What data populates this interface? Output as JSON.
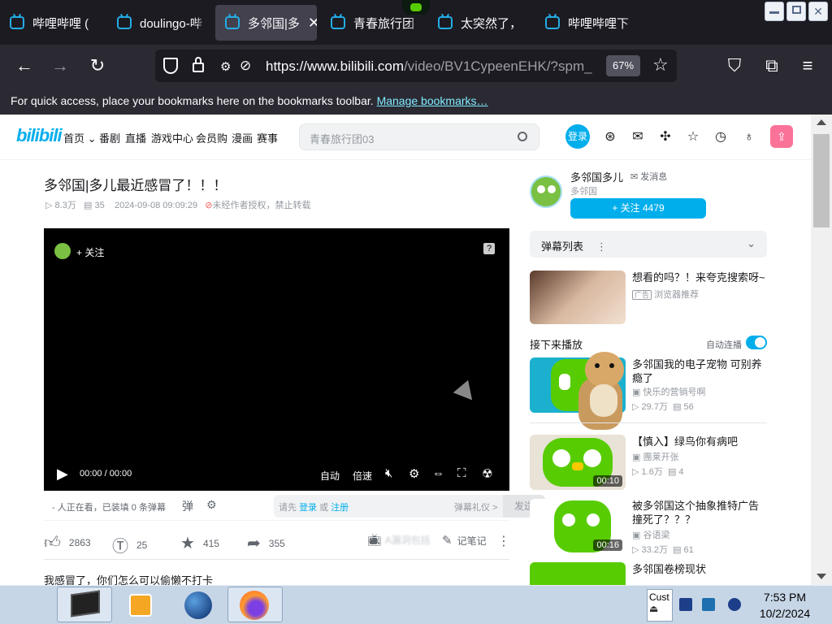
{
  "browser": {
    "tabs": [
      {
        "label": "哔哩哔哩 (",
        "active": false
      },
      {
        "label": "doulingo-哔",
        "active": false
      },
      {
        "label": "多邻国|多",
        "active": true
      },
      {
        "label": "青春旅行团",
        "active": false
      },
      {
        "label": "太突然了，",
        "active": false
      },
      {
        "label": "哔哩哔哩下",
        "active": false
      }
    ],
    "url_main": "https://www.bilibili.com",
    "url_rest": "/video/BV1CypeenEHK/?spm_",
    "zoom": "67%",
    "bookmarks_text": "For quick access, place your bookmarks here on the bookmarks toolbar.",
    "bookmarks_link": "Manage bookmarks…"
  },
  "site": {
    "logo": "bilibili",
    "nav": [
      "首页",
      "番剧",
      "直播",
      "游戏中心",
      "会员购",
      "漫画",
      "赛事"
    ],
    "search_placeholder": "青春旅行团03",
    "login": "登录"
  },
  "video": {
    "title": "多邻国|多儿最近感冒了！！！",
    "views": "8.3万",
    "danmaku_count": "35",
    "date": "2024-09-08 09:09:29",
    "copyright": "未经作者授权，禁止转载",
    "follow_in_player": "+ 关注",
    "time": "00:00 / 00:00",
    "auto": "自动",
    "speed": "倍速",
    "watching": "- 人正在看，已装填 0 条弹幕",
    "dm_prompt_pre": "请先",
    "dm_login": "登录",
    "dm_or": "或",
    "dm_register": "注册",
    "dm_gift": "弹幕礼仪 >",
    "dm_send": "发送",
    "likes": "2863",
    "coins": "25",
    "favs": "415",
    "shares": "355",
    "note": "记笔记",
    "desc": "我感冒了，你们怎么可以偷懒不打卡"
  },
  "uploader": {
    "name": "多邻国多儿",
    "message": "发消息",
    "sub": "多邻国",
    "follow": "+ 关注 4479"
  },
  "sidebar": {
    "danmaku_list": "弹幕列表",
    "ad_title": "想看的吗？！来夸克搜索呀~",
    "ad_tag": "广告",
    "ad_source": "浏览器推荐",
    "next_up": "接下来播放",
    "autoplay": "自动连播",
    "videos": [
      {
        "title": "多邻国我的电子宠物 可别养瘾了",
        "author": "快乐的营销号啊",
        "views": "29.7万",
        "dm": "56",
        "duration": ""
      },
      {
        "title": "【慎入】绿鸟你有病吧",
        "author": "團莱开张",
        "views": "1.6万",
        "dm": "4",
        "duration": "00:10"
      },
      {
        "title": "被多邻国这个抽象推特广告撞死了？？？",
        "author": "谷语梁",
        "views": "33.2万",
        "dm": "61",
        "duration": "00:16"
      },
      {
        "title": "多邻国卷榜现状",
        "author": "",
        "views": "",
        "dm": "",
        "duration": ""
      }
    ]
  },
  "taskbar": {
    "time": "7:53 PM",
    "date": "10/2/2024",
    "cust": "Cust"
  },
  "colors": {
    "brand": "#00aeec",
    "pink": "#fb7299",
    "duolingo": "#58cc02"
  }
}
